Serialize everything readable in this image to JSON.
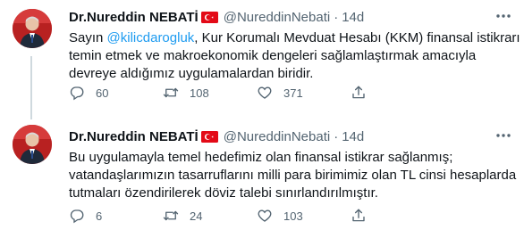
{
  "tweets": [
    {
      "display_name": "Dr.Nureddin NEBATİ",
      "handle": "@NureddinNebati",
      "separator": "·",
      "time": "14d",
      "text_lines": [
        [
          "Sayın ",
          "@kilicdarogluk",
          ", Kur Korumalı Mevduat Hesabı (KKM) finansal istikrarı"
        ],
        "temin etmek ve makroekonomik dengeleri sağlamlaştırmak amacıyla",
        "devreye aldığımız uygulamalardan biridir."
      ],
      "replies": "60",
      "retweets": "108",
      "likes": "371"
    },
    {
      "display_name": "Dr.Nureddin NEBATİ",
      "handle": "@NureddinNebati",
      "separator": "·",
      "time": "14d",
      "text_lines": [
        "Bu uygulamayla temel hedefimiz olan finansal istikrar sağlanmış;",
        "vatandaşlarımızın tasarruflarını milli para birimimiz olan TL cinsi hesaplarda",
        "tutmaları özendirilerek döviz talebi sınırlandırılmıştır."
      ],
      "replies": "6",
      "retweets": "24",
      "likes": "103"
    }
  ],
  "icons": {
    "more": "more-horizontal-icon",
    "reply": "reply-icon",
    "retweet": "retweet-icon",
    "like": "heart-icon",
    "share": "share-icon",
    "flag": "turkish-flag-icon"
  },
  "colors": {
    "text": "#0f1419",
    "secondary": "#536471",
    "mention": "#1d9bf0",
    "flag_red": "#e30a17"
  }
}
